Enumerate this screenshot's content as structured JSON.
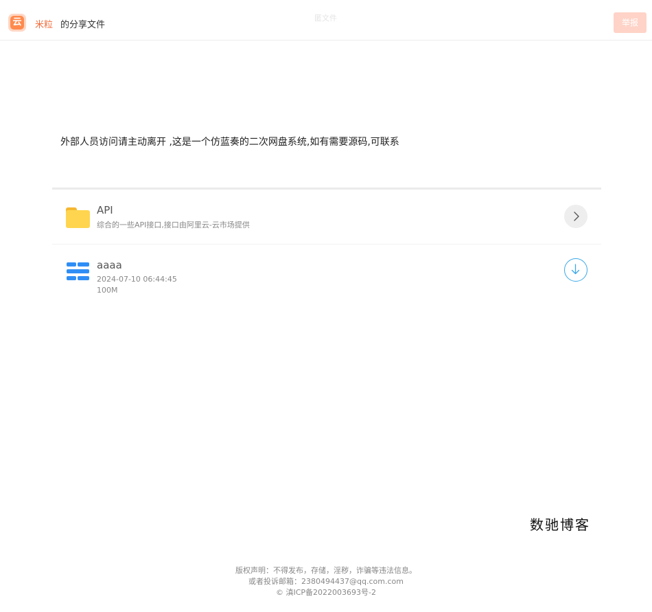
{
  "header": {
    "logo_glyph": "云",
    "owner_name": "米粒",
    "share_suffix": "的分享文件",
    "ghost_title": "匿文件",
    "report_label": "举报"
  },
  "notice": "外部人员访问请主动离开 ,这是一个仿蓝奏的二次网盘系统,如有需要源码,可联系",
  "items": [
    {
      "type": "folder",
      "name": "API",
      "description": "综合的一些API接口,接口由阿里云-云市场提供",
      "action_icon": "chevron-right-icon"
    },
    {
      "type": "file",
      "name": "aaaa",
      "date": "2024-07-10 06:44:45",
      "size": "100M",
      "action_icon": "download-icon"
    }
  ],
  "signature": "数驰博客",
  "footer": {
    "line1": "版权声明：不得发布，存储，淫秽，诈骗等违法信息。",
    "line2": "或者投诉邮箱：2380494437@qq.com.com",
    "line3": "© 滇ICP备2022003693号-2"
  },
  "colors": {
    "accent": "#f26b3a",
    "report_button": "#ffd3c7",
    "folder": "#ffd54f",
    "file_icon": "#2f8ef5",
    "download_ring": "#3aa7e8"
  }
}
